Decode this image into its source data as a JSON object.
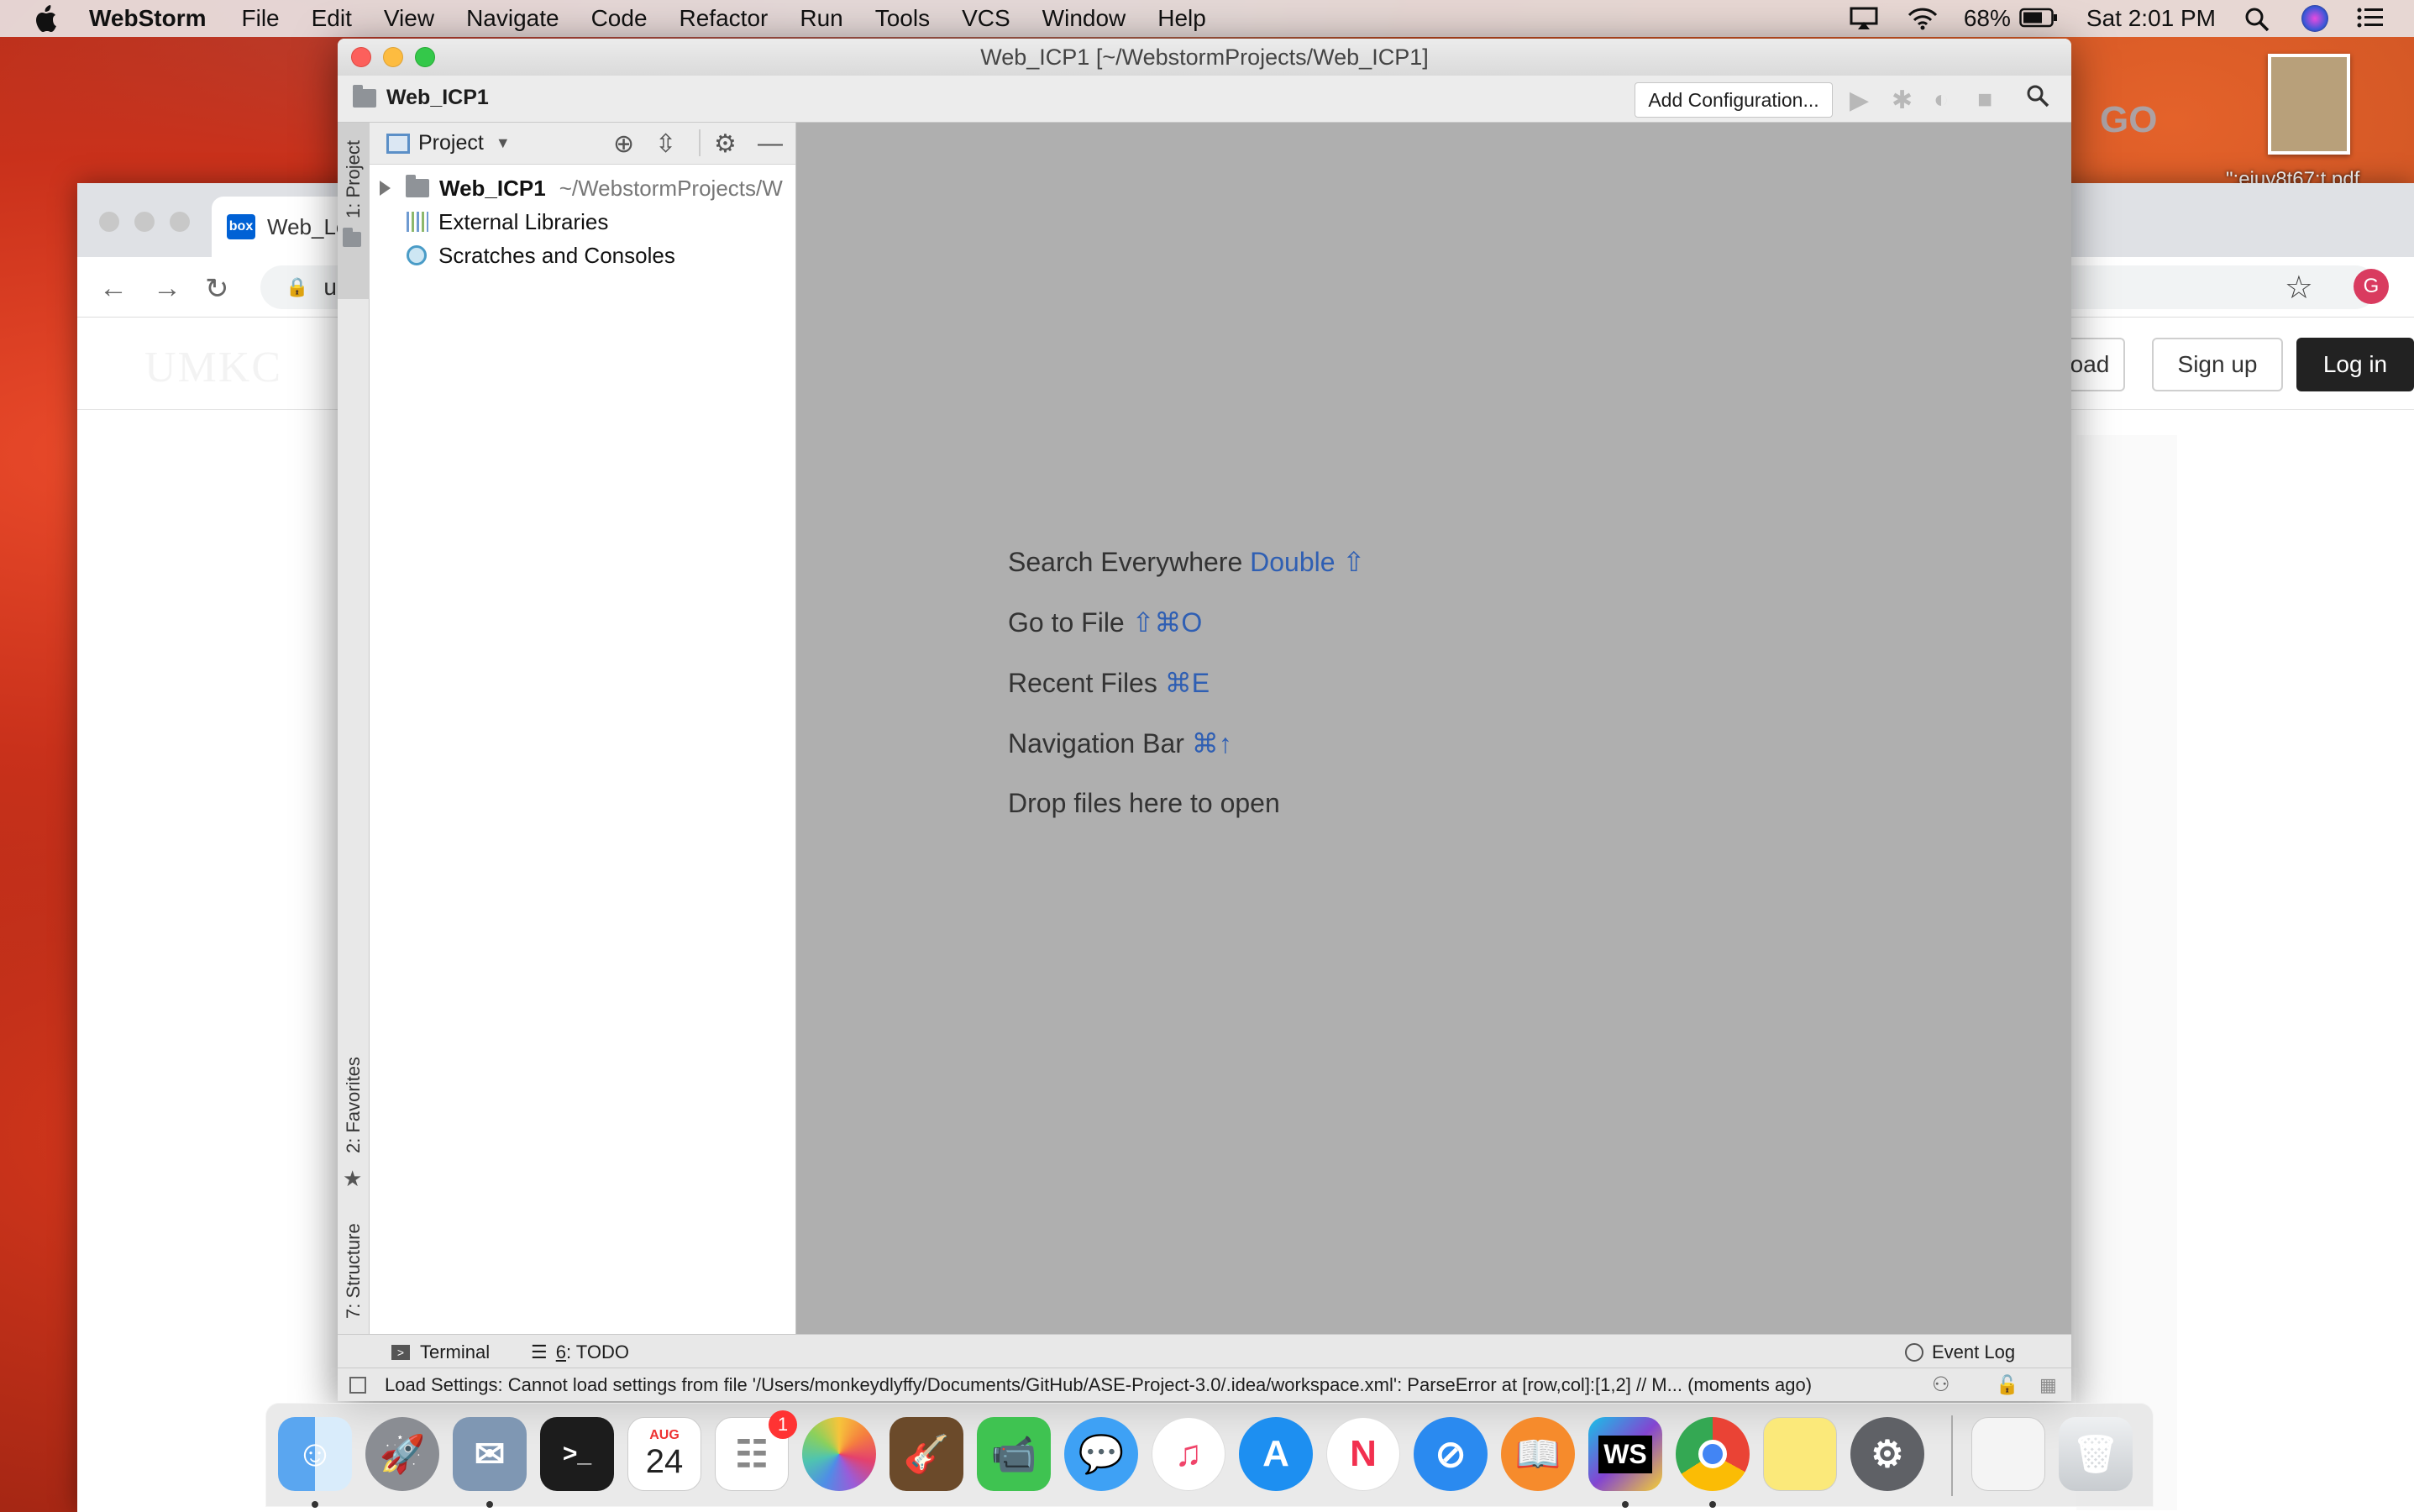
{
  "menubar": {
    "app": "WebStorm",
    "items": [
      "File",
      "Edit",
      "View",
      "Navigate",
      "Code",
      "Refactor",
      "Run",
      "Tools",
      "VCS",
      "Window",
      "Help"
    ],
    "battery": "68%",
    "clock": "Sat 2:01 PM"
  },
  "desktop": {
    "pdf_label": "\":ejuy8t67:t.pdf",
    "go_label": "GO"
  },
  "chrome": {
    "tab_title": "Web_Le",
    "tab_icon": "box",
    "url": "ur",
    "logo": "UMKC",
    "load_label": "oad",
    "signup_label": "Sign up",
    "login_label": "Log in",
    "avatar_letter": "G"
  },
  "ide": {
    "window_title": "Web_ICP1 [~/WebstormProjects/Web_ICP1]",
    "breadcrumb": "Web_ICP1",
    "add_config": "Add Configuration...",
    "project_selector": "Project",
    "tree": {
      "root_name": "Web_ICP1",
      "root_path": "~/WebstormProjects/W",
      "external": "External Libraries",
      "scratches": "Scratches and Consoles"
    },
    "side_tabs": {
      "project": "1: Project",
      "favorites": "2: Favorites",
      "structure": "7: Structure"
    },
    "hints": [
      {
        "text": "Search Everywhere",
        "key": "Double ⇧"
      },
      {
        "text": "Go to File",
        "key": "⇧⌘O"
      },
      {
        "text": "Recent Files",
        "key": "⌘E"
      },
      {
        "text": "Navigation Bar",
        "key": "⌘↑"
      },
      {
        "text": "Drop files here to open",
        "key": ""
      }
    ],
    "bottom": {
      "terminal": "Terminal",
      "todo_num": "6",
      "todo": ": TODO",
      "event_log": "Event Log"
    },
    "status": "Load Settings: Cannot load settings from file '/Users/monkeydlyffy/Documents/GitHub/ASE-Project-3.0/.idea/workspace.xml': ParseError at [row,col]:[1,2] // M... (moments ago)"
  },
  "dock": {
    "calendar_month": "AUG",
    "calendar_day": "24",
    "reminders_badge": "1",
    "ws_label": "WS"
  },
  "colors": {
    "key_hint": "#2f5fb3",
    "editor_bg": "#afafaf",
    "login_bg": "#222222"
  }
}
